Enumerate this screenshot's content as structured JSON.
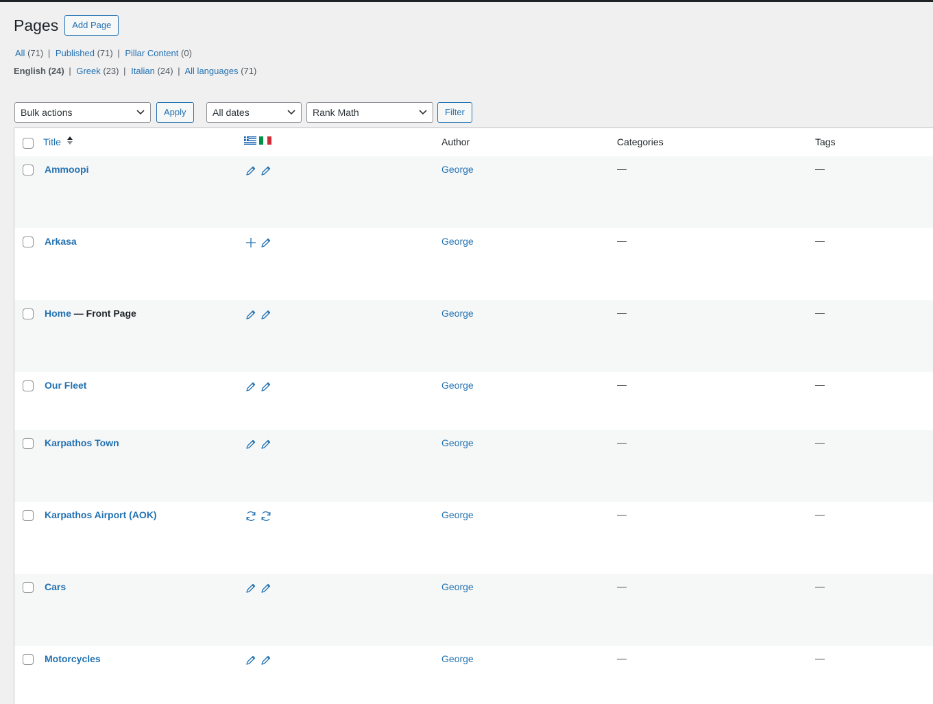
{
  "header": {
    "title": "Pages",
    "add_button": "Add Page"
  },
  "views": [
    {
      "label": "All",
      "count": "(71)"
    },
    {
      "label": "Published",
      "count": "(71)"
    },
    {
      "label": "Pillar Content",
      "count": "(0)"
    }
  ],
  "languages": {
    "current": "English (24)",
    "items": [
      {
        "label": "Greek",
        "count": "(23)"
      },
      {
        "label": "Italian",
        "count": "(24)"
      },
      {
        "label": "All languages",
        "count": "(71)"
      }
    ]
  },
  "filters": {
    "bulk_actions": "Bulk actions",
    "apply": "Apply",
    "dates": "All dates",
    "seo": "Rank Math",
    "filter": "Filter"
  },
  "columns": {
    "title": "Title",
    "lang_flags": [
      "greek-flag-icon",
      "italian-flag-icon"
    ],
    "author": "Author",
    "categories": "Categories",
    "tags": "Tags"
  },
  "rows": [
    {
      "title": "Ammoopi",
      "state": "",
      "greek": "pencil-icon",
      "italian": "pencil-icon",
      "author": "George",
      "categories": "—",
      "tags": "—"
    },
    {
      "title": "Arkasa",
      "state": "",
      "greek": "plus-icon",
      "italian": "pencil-icon",
      "author": "George",
      "categories": "—",
      "tags": "—"
    },
    {
      "title": "Home",
      "state": " — Front Page",
      "greek": "pencil-icon",
      "italian": "pencil-icon",
      "author": "George",
      "categories": "—",
      "tags": "—"
    },
    {
      "title": "Our Fleet",
      "state": "",
      "greek": "pencil-icon",
      "italian": "pencil-icon",
      "author": "George",
      "categories": "—",
      "tags": "—"
    },
    {
      "title": "Karpathos Town",
      "state": "",
      "greek": "pencil-icon",
      "italian": "pencil-icon",
      "author": "George",
      "categories": "—",
      "tags": "—"
    },
    {
      "title": "Karpathos Airport (AOK)",
      "state": "",
      "greek": "sync-icon",
      "italian": "sync-icon",
      "author": "George",
      "categories": "—",
      "tags": "—"
    },
    {
      "title": "Cars",
      "state": "",
      "greek": "pencil-icon",
      "italian": "pencil-icon",
      "author": "George",
      "categories": "—",
      "tags": "—"
    },
    {
      "title": "Motorcycles",
      "state": "",
      "greek": "pencil-icon",
      "italian": "pencil-icon",
      "author": "George",
      "categories": "—",
      "tags": "—"
    }
  ],
  "colors": {
    "link": "#2271b1",
    "alt_row": "#f6f7f7",
    "background": "#f0f0f1"
  }
}
